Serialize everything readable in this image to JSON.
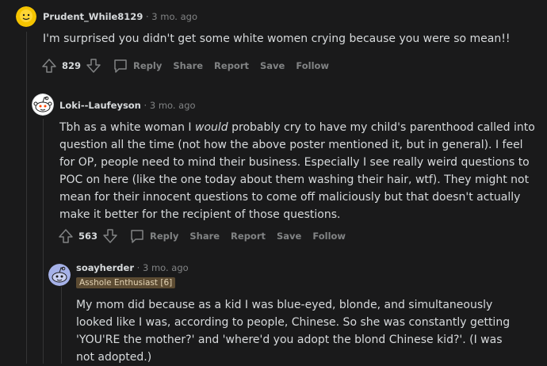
{
  "comments": [
    {
      "author": "Prudent_While8129",
      "separator": "·",
      "time": "3 mo. ago",
      "body": "I'm surprised you didn't get some white women crying because you were so mean!!",
      "score": "829",
      "actions": [
        "Reply",
        "Share",
        "Report",
        "Save",
        "Follow"
      ],
      "avatar_icon": "yellow-face-avatar-icon"
    },
    {
      "author": "Loki--Laufeyson",
      "separator": "·",
      "time": "3 mo. ago",
      "body_before": "Tbh as a white woman I ",
      "body_em": "would",
      "body_after": " probably cry to have my child's parenthood called into question all the time (not how the above poster mentioned it, but in general). I feel for OP, people need to mind their business. Especially I see really weird questions to POC on here (like the one today about them washing their hair, wtf). They might not mean for their innocent questions to come off maliciously but that doesn't actually make it better for the recipient of those questions.",
      "score": "563",
      "actions": [
        "Reply",
        "Share",
        "Report",
        "Save",
        "Follow"
      ],
      "avatar_icon": "snoo-avatar-icon"
    },
    {
      "author": "soayherder",
      "separator": "·",
      "time": "3 mo. ago",
      "flair": "Asshole Enthusiast [6]",
      "body": "My mom did because as a kid I was blue-eyed, blonde, and simultaneously looked like I was, according to people, Chinese. So she was constantly getting 'YOU'RE the mother?' and 'where'd you adopt the blond Chinese kid?'. (I was not adopted.)",
      "avatar_icon": "purple-snoo-avatar-icon"
    }
  ],
  "colors": {
    "background": "#1a1a1b",
    "text": "#d7dadc",
    "muted": "#818384",
    "flair_bg": "#5c4b32"
  }
}
